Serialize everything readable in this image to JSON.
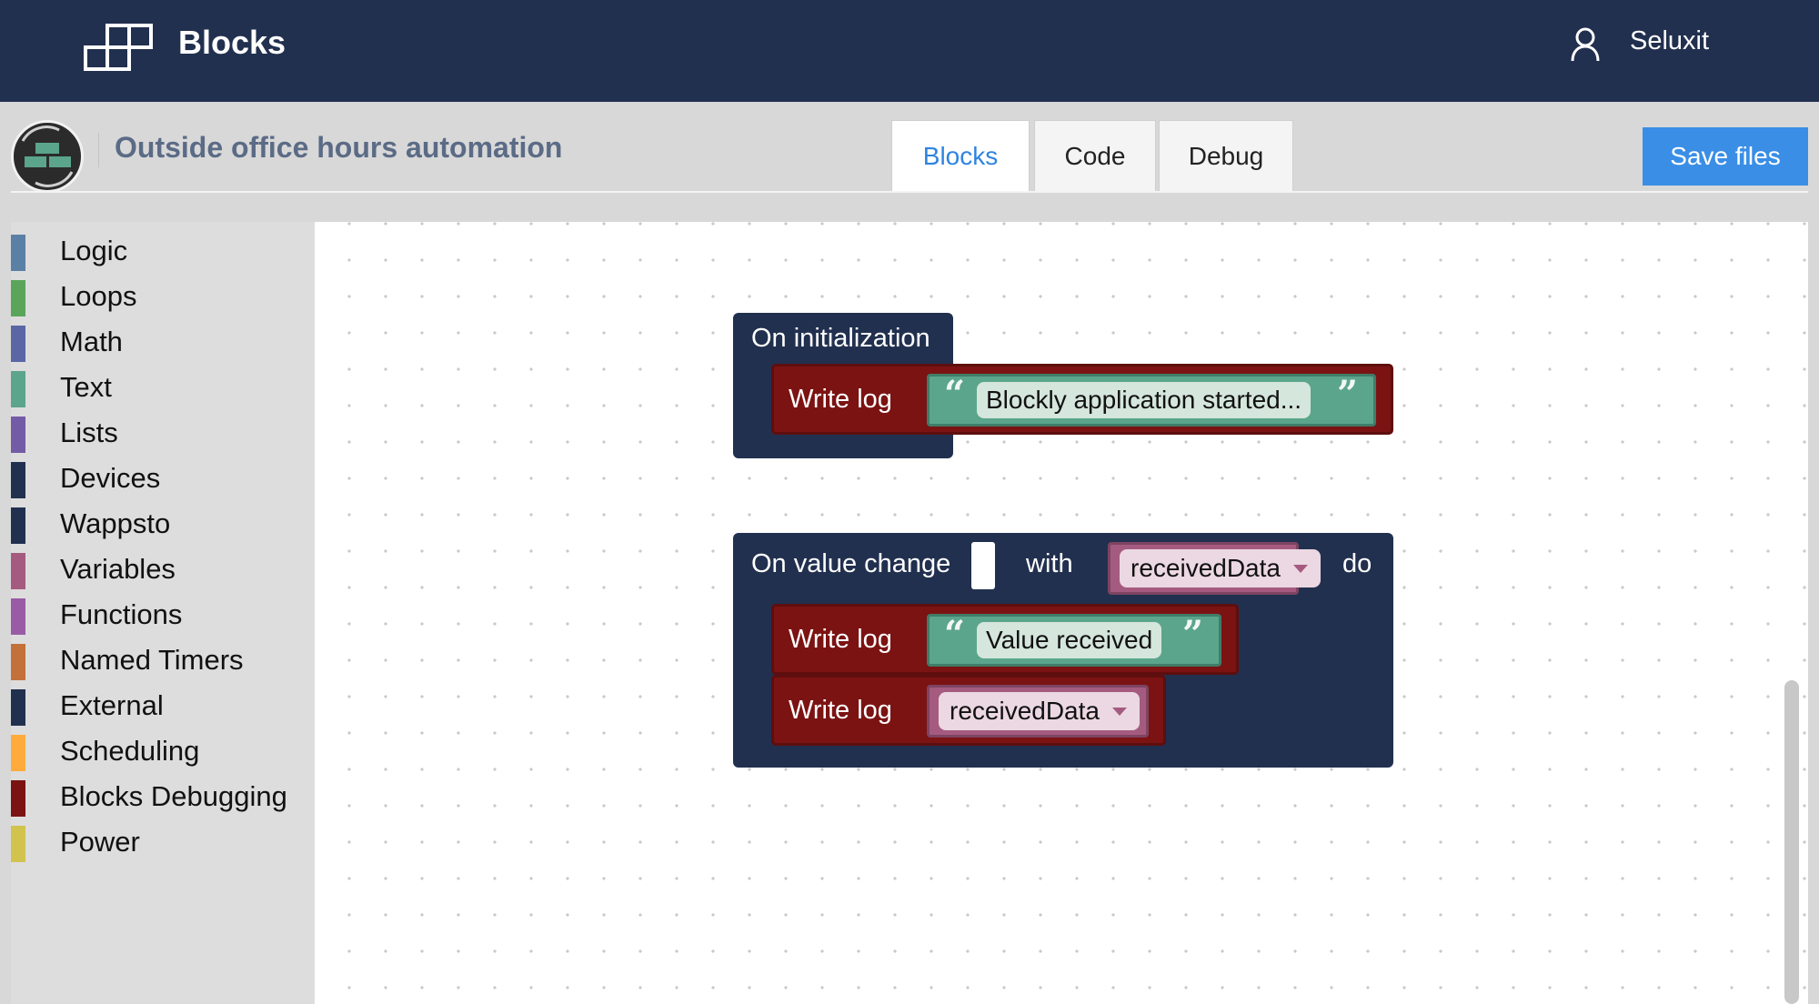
{
  "header": {
    "app_title": "Blocks",
    "user_name": "Seluxit"
  },
  "project": {
    "title": "Outside office hours automation"
  },
  "tabs": [
    {
      "label": "Blocks",
      "active": true
    },
    {
      "label": "Code",
      "active": false
    },
    {
      "label": "Debug",
      "active": false
    }
  ],
  "save_button": "Save files",
  "toolbox": {
    "categories": [
      {
        "label": "Logic",
        "color": "#5b80a5"
      },
      {
        "label": "Loops",
        "color": "#5ba55b"
      },
      {
        "label": "Math",
        "color": "#5b67a5"
      },
      {
        "label": "Text",
        "color": "#5ba58c"
      },
      {
        "label": "Lists",
        "color": "#745ba5"
      },
      {
        "label": "Devices",
        "color": "#22304f"
      },
      {
        "label": "Wappsto",
        "color": "#22304f"
      },
      {
        "label": "Variables",
        "color": "#a55b80"
      },
      {
        "label": "Functions",
        "color": "#995ba5"
      },
      {
        "label": "Named Timers",
        "color": "#c4703a"
      },
      {
        "label": "External",
        "color": "#22304f"
      },
      {
        "label": "Scheduling",
        "color": "#ffab3b"
      },
      {
        "label": "Blocks Debugging",
        "color": "#7b1313"
      },
      {
        "label": "Power",
        "color": "#d2c34e"
      }
    ]
  },
  "workspace": {
    "init_block": {
      "header": "On initialization",
      "write_label": "Write log",
      "message": "Blockly application started..."
    },
    "change_block": {
      "header": "On value change",
      "with_label": "with",
      "variable": "receivedData",
      "do_label": "do",
      "write1_label": "Write log",
      "message": "Value received",
      "write2_label": "Write log",
      "log_variable": "receivedData"
    }
  },
  "colors": {
    "nav": "#22304f",
    "accent": "#3a8ee6",
    "log_block": "#7b1313",
    "text_block": "#5ba58c",
    "variable_block": "#a55b80"
  }
}
